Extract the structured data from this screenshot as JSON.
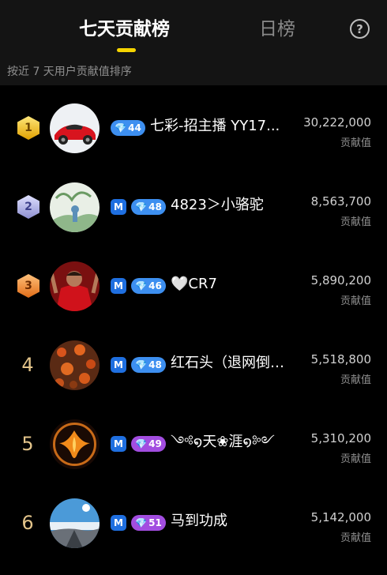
{
  "header": {
    "tab_weekly": "七天贡献榜",
    "tab_daily": "日榜",
    "help_symbol": "?",
    "subtitle": "按近 7 天用户贡献值排序"
  },
  "colors": {
    "accent": "#f5d400",
    "rank_gold": "#e3c48a",
    "level_blue": "#3d8ff0",
    "level_purple": "#a24de0"
  },
  "list": {
    "score_label": "贡献值",
    "m_badge": "M",
    "gem_icon": "💎",
    "items": [
      {
        "rank": "1",
        "level": "44",
        "name": "七彩-招主播 YY17...",
        "score": "30,222,000"
      },
      {
        "rank": "2",
        "level": "48",
        "name": "4823＞小骆驼",
        "score": "8,563,700"
      },
      {
        "rank": "3",
        "level": "46",
        "name": "🤍CR7",
        "score": "5,890,200"
      },
      {
        "rank": "4",
        "level": "48",
        "name": "红石头（退网倒…",
        "score": "5,518,800"
      },
      {
        "rank": "5",
        "level": "49",
        "name": "༺໑天❀涯໑༻",
        "score": "5,310,200"
      },
      {
        "rank": "6",
        "level": "51",
        "name": "马到功成",
        "score": "5,142,000"
      }
    ]
  }
}
